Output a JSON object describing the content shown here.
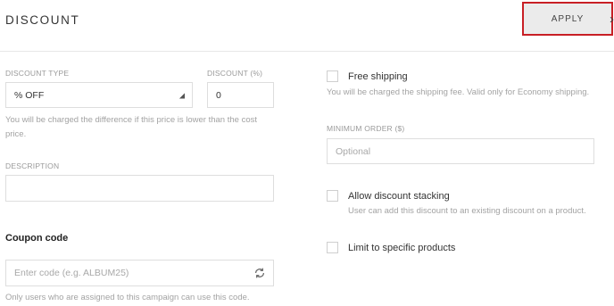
{
  "header": {
    "title": "DISCOUNT",
    "apply_label": "APPLY"
  },
  "left": {
    "discount_type": {
      "label": "DISCOUNT TYPE",
      "value": "% OFF"
    },
    "discount_percent": {
      "label": "DISCOUNT (%)",
      "value": "0"
    },
    "difference_help": "You will be charged the difference if this price is lower than the cost price.",
    "description": {
      "label": "DESCRIPTION",
      "value": ""
    },
    "coupon": {
      "heading": "Coupon code",
      "placeholder": "Enter code (e.g. ALBUM25)",
      "help": "Only users who are assigned to this campaign can use this code."
    }
  },
  "right": {
    "free_shipping": {
      "label": "Free shipping",
      "checked": false,
      "help": "You will be charged the shipping fee. Valid only for Economy shipping."
    },
    "minimum_order": {
      "label": "MINIMUM ORDER ($)",
      "placeholder": "Optional"
    },
    "allow_stacking": {
      "label": "Allow discount stacking",
      "checked": false,
      "help": "User can add this discount to an existing discount on a product."
    },
    "limit_products": {
      "label": "Limit to specific products",
      "checked": false
    }
  },
  "colors": {
    "apply_border": "#c81f25",
    "apply_bg": "#ebebeb"
  },
  "icons": {
    "select_caret": "caret-down-icon",
    "refresh": "refresh-icon"
  }
}
